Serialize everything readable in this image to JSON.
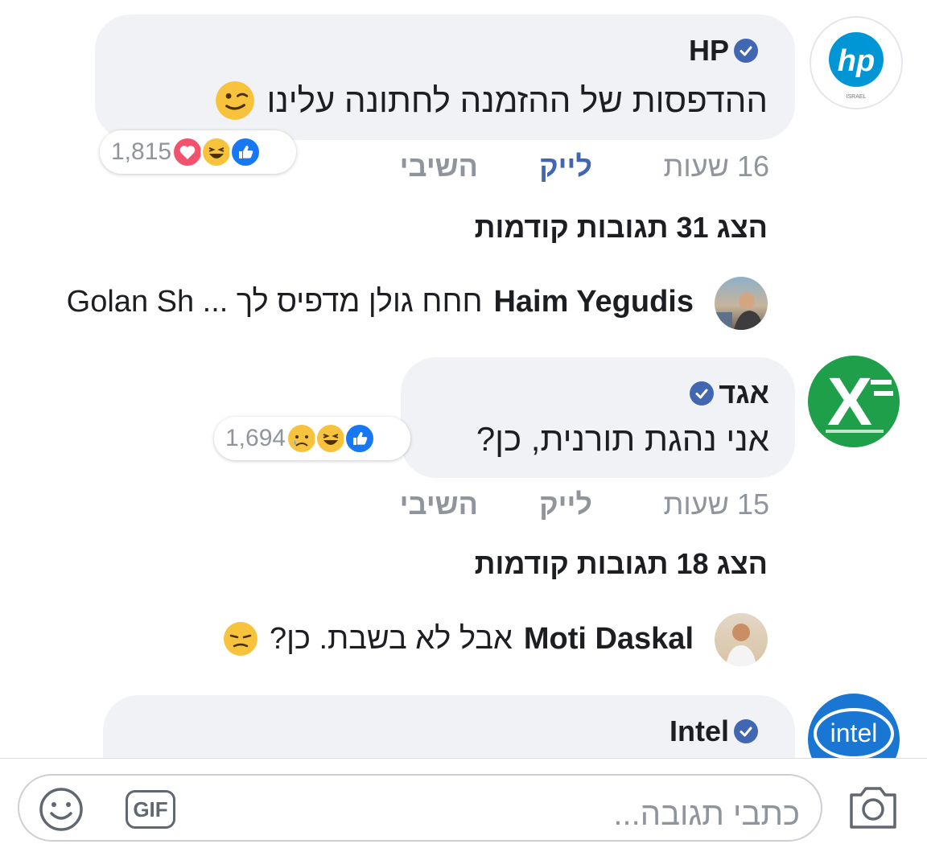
{
  "comments": [
    {
      "author": "HP",
      "text": "ההדפסות של ההזמנה לחתונה עלינו",
      "reaction_count": "1,815",
      "time": "16 שעות",
      "like_label": "לייק",
      "reply_label": "השיבי",
      "show_previous": "הצג 31 תגובות קודמות",
      "reply": {
        "author": "Haim Yegudis",
        "text": "חחח גולן מדפיס לך ... Golan Sh"
      }
    },
    {
      "author": "אגד",
      "text": "אני נהגת תורנית, כן?",
      "reaction_count": "1,694",
      "time": "15 שעות",
      "like_label": "לייק",
      "reply_label": "השיבי",
      "show_previous": "הצג 18 תגובות קודמות",
      "reply": {
        "author": "Moti Daskal",
        "text": "אבל לא בשבת. כן?"
      }
    },
    {
      "author": "Intel"
    }
  ],
  "logos": {
    "hp": "hp",
    "hp_sub": "ISRAEL",
    "egged": "X",
    "intel": "intel"
  },
  "composer": {
    "placeholder": "כתבי תגובה...",
    "gif_label": "GIF"
  },
  "colors": {
    "facebook_blue": "#4267b2",
    "bubble_bg": "#f0f2f5",
    "meta_gray": "#90949c",
    "egged_green": "#1f9f4a",
    "hp_blue": "#0096d6",
    "intel_blue": "#1976d2"
  },
  "icons": [
    "verified-badge-icon",
    "like-reaction-icon",
    "haha-reaction-icon",
    "love-reaction-icon",
    "sad-reaction-icon",
    "wink-emoji-icon",
    "unamused-emoji-icon",
    "camera-icon",
    "gif-icon",
    "smiley-icon"
  ]
}
